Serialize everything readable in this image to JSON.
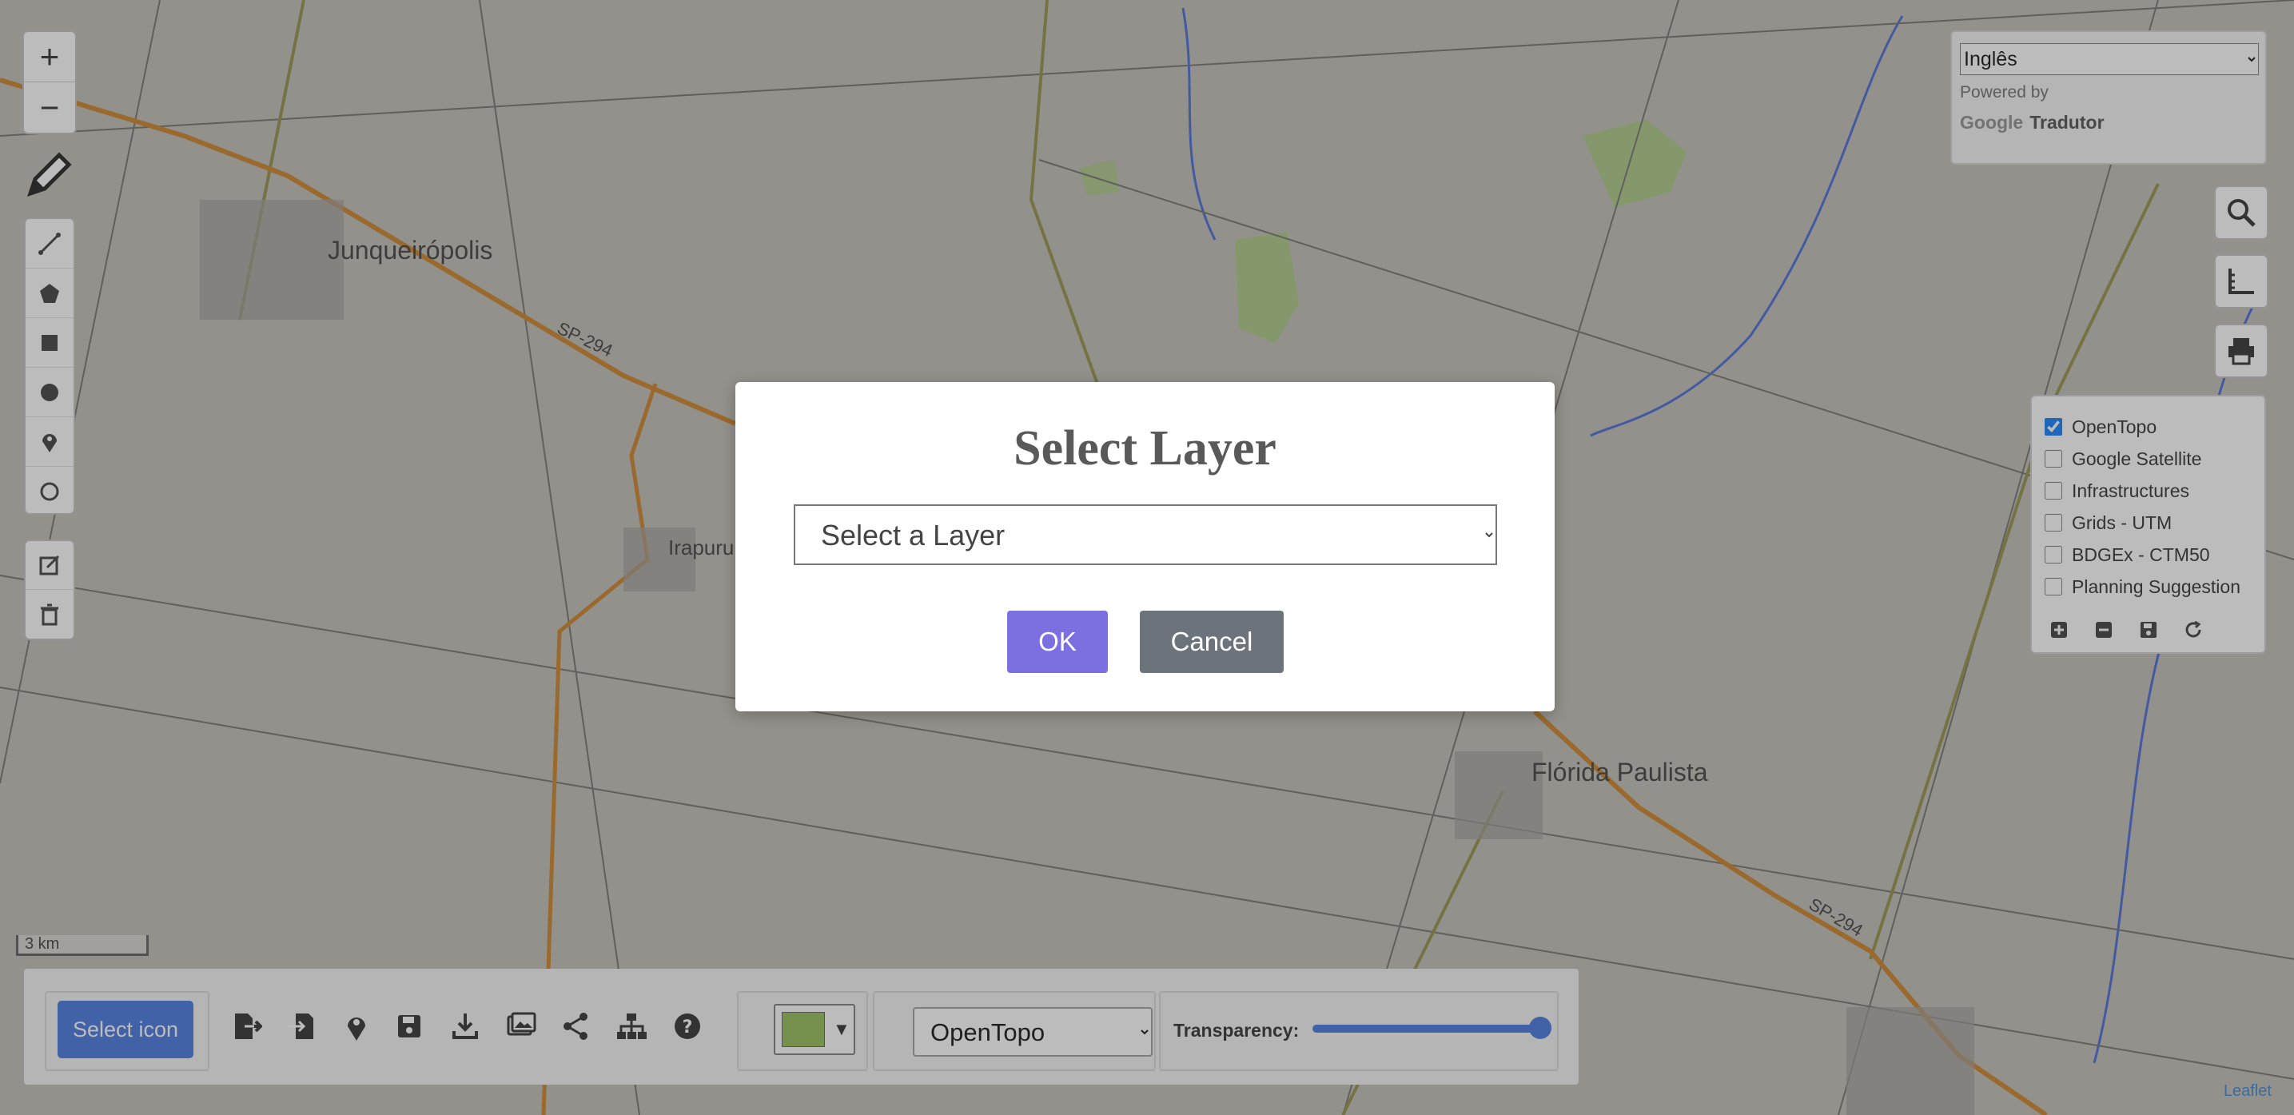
{
  "map": {
    "places": [
      "Junqueirópolis",
      "Irapuru",
      "Flórida Paulista"
    ],
    "road_labels": [
      "SP-294",
      "SP-294"
    ],
    "scale": "3 km",
    "attribution": "Leaflet"
  },
  "zoom": {
    "in_label": "+",
    "out_label": "−"
  },
  "translate": {
    "language": "Inglês",
    "powered_by": "Powered by",
    "google": "Google",
    "service": "Tradutor"
  },
  "layers": {
    "items": [
      {
        "label": "OpenTopo",
        "checked": true
      },
      {
        "label": "Google Satellite",
        "checked": false
      },
      {
        "label": "Infrastructures",
        "checked": false
      },
      {
        "label": "Grids - UTM",
        "checked": false
      },
      {
        "label": "BDGEx - CTM50",
        "checked": false
      },
      {
        "label": "Planning Suggestion",
        "checked": false
      }
    ]
  },
  "toolbar": {
    "select_icon_label": "Select icon",
    "color": "#8fb84d",
    "basemap": "OpenTopo",
    "transparency_label": "Transparency:",
    "transparency_value": 0.95
  },
  "modal": {
    "title": "Select Layer",
    "placeholder": "Select a Layer",
    "ok_label": "OK",
    "cancel_label": "Cancel"
  },
  "colors": {
    "primary": "#3b6fde",
    "ok": "#7c6fe0",
    "cancel": "#6c737b",
    "road": "#c87a1a",
    "green_area": "#9ccc65"
  }
}
